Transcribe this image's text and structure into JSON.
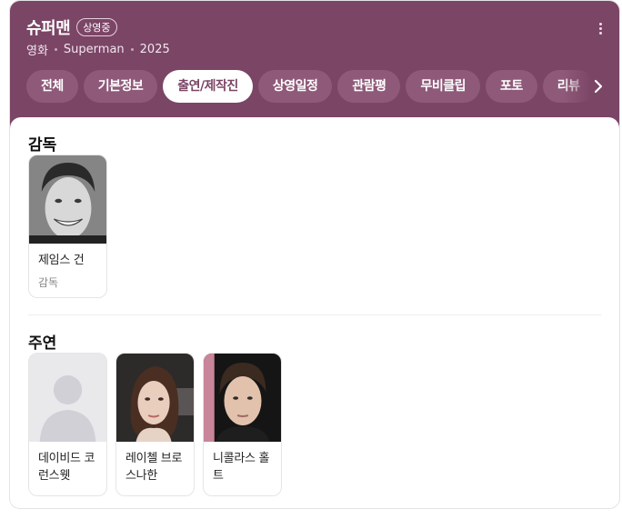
{
  "header": {
    "title": "슈퍼맨",
    "badge": "상영중",
    "meta": [
      "영화",
      "Superman",
      "2025"
    ],
    "accent_color": "#7b4566",
    "more_icon": "more-vertical-icon",
    "next_icon": "chevron-right-icon"
  },
  "tabs": [
    {
      "label": "전체"
    },
    {
      "label": "기본정보"
    },
    {
      "label": "출연/제작진",
      "active": true
    },
    {
      "label": "상영일정"
    },
    {
      "label": "관람평"
    },
    {
      "label": "무비클립"
    },
    {
      "label": "포토"
    },
    {
      "label": "리뷰"
    }
  ],
  "sections": {
    "director": {
      "title": "감독",
      "people": [
        {
          "name": "제임스 건",
          "role": "감독"
        }
      ]
    },
    "cast": {
      "title": "주연",
      "people": [
        {
          "name": "데이비드 코런스웻"
        },
        {
          "name": "레이첼 브로스나한"
        },
        {
          "name": "니콜라스 홀트"
        }
      ]
    }
  }
}
